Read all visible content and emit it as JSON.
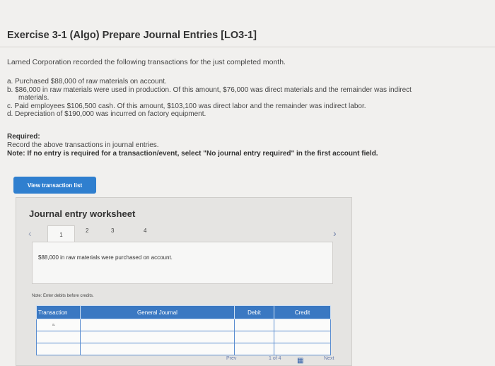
{
  "title": "Exercise 3-1 (Algo) Prepare Journal Entries [LO3-1]",
  "intro": "Larned Corporation recorded the following transactions for the just completed month.",
  "transactions": [
    "a. Purchased $88,000 of raw materials on account.",
    "b. $86,000 in raw materials were used in production. Of this amount, $76,000 was direct materials and the remainder was indirect",
    "materials.",
    "c. Paid employees $106,500 cash. Of this amount, $103,100 was direct labor and the remainder was indirect labor.",
    "d. Depreciation of $190,000 was incurred on factory equipment."
  ],
  "required": {
    "heading": "Required:",
    "instruction": "Record the above transactions in journal entries.",
    "note": "Note: If no entry is required for a transaction/event, select \"No journal entry required\" in the first account field."
  },
  "view_button": "View transaction list",
  "worksheet": {
    "title": "Journal entry worksheet",
    "pages": [
      "1",
      "2",
      "3",
      "4"
    ],
    "description": "$88,000 in raw materials were purchased on account.",
    "note": "Note: Enter debits before credits.",
    "columns": [
      "Transaction",
      "General Journal",
      "Debit",
      "Credit"
    ],
    "rows": [
      {
        "transaction": "a."
      },
      {
        "transaction": ""
      },
      {
        "transaction": ""
      }
    ]
  },
  "bottom_nav": {
    "prev": "Prev",
    "page_info": "1 of 4",
    "next": "Next"
  }
}
